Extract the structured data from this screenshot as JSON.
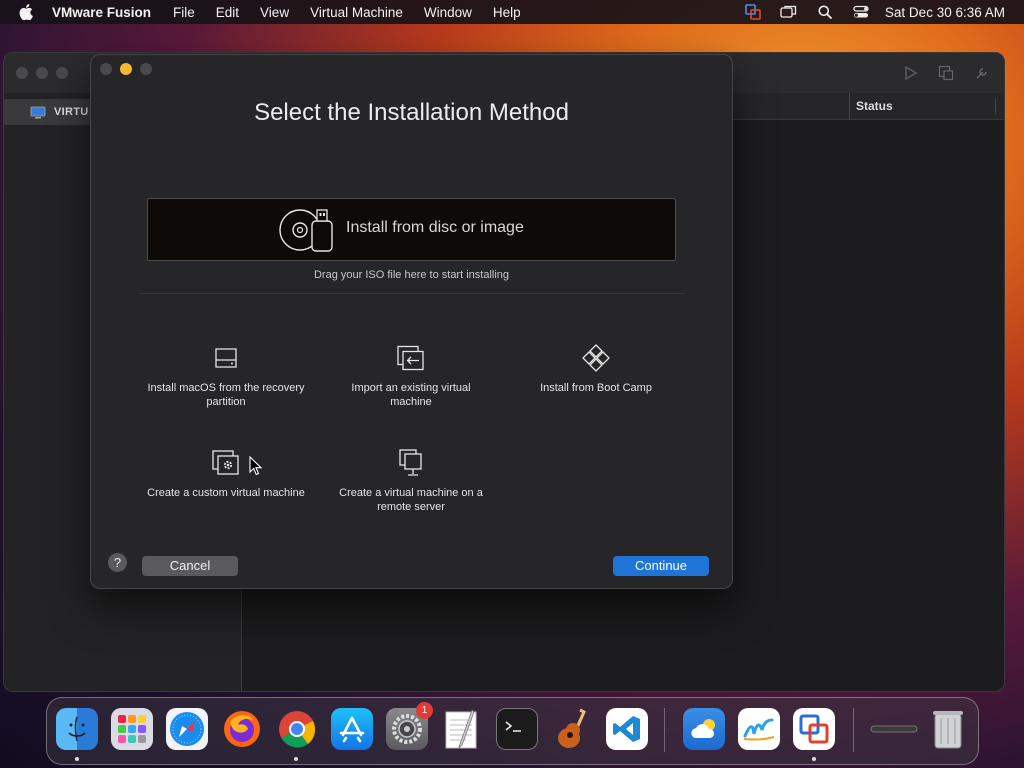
{
  "menubar": {
    "app_name": "VMware Fusion",
    "items": [
      "File",
      "Edit",
      "View",
      "Virtual Machine",
      "Window",
      "Help"
    ],
    "clock": "Sat Dec 30  6:36 AM"
  },
  "library": {
    "sidebar_label": "VIRTU",
    "status_header": "Status"
  },
  "dialog": {
    "title": "Select the Installation Method",
    "dropzone_label": "Install from disc or image",
    "drag_hint": "Drag your ISO file here to start installing",
    "options": [
      {
        "label": "Install macOS from the recovery partition",
        "icon": "drive-icon"
      },
      {
        "label": "Import an existing virtual machine",
        "icon": "import-icon"
      },
      {
        "label": "Install from Boot Camp",
        "icon": "bootcamp-icon"
      },
      {
        "label": "Create a custom virtual machine",
        "icon": "custom-vm-icon"
      },
      {
        "label": "Create a virtual machine on a remote server",
        "icon": "remote-server-icon"
      }
    ],
    "help_label": "?",
    "cancel_label": "Cancel",
    "continue_label": "Continue"
  },
  "dock": {
    "apps": [
      "Finder",
      "Launchpad",
      "Safari",
      "Firefox",
      "Chrome",
      "App Store",
      "System Settings",
      "TextEdit",
      "Terminal",
      "GarageBand",
      "Visual Studio Code",
      "Weather",
      "Freeform",
      "VMware Fusion",
      "Downloads",
      "Trash"
    ],
    "settings_badge": "1"
  },
  "colors": {
    "accent": "#1f74d8",
    "dialog_bg": "#262628",
    "dropzone_bg": "#0d0a08",
    "badge": "#e53935"
  }
}
